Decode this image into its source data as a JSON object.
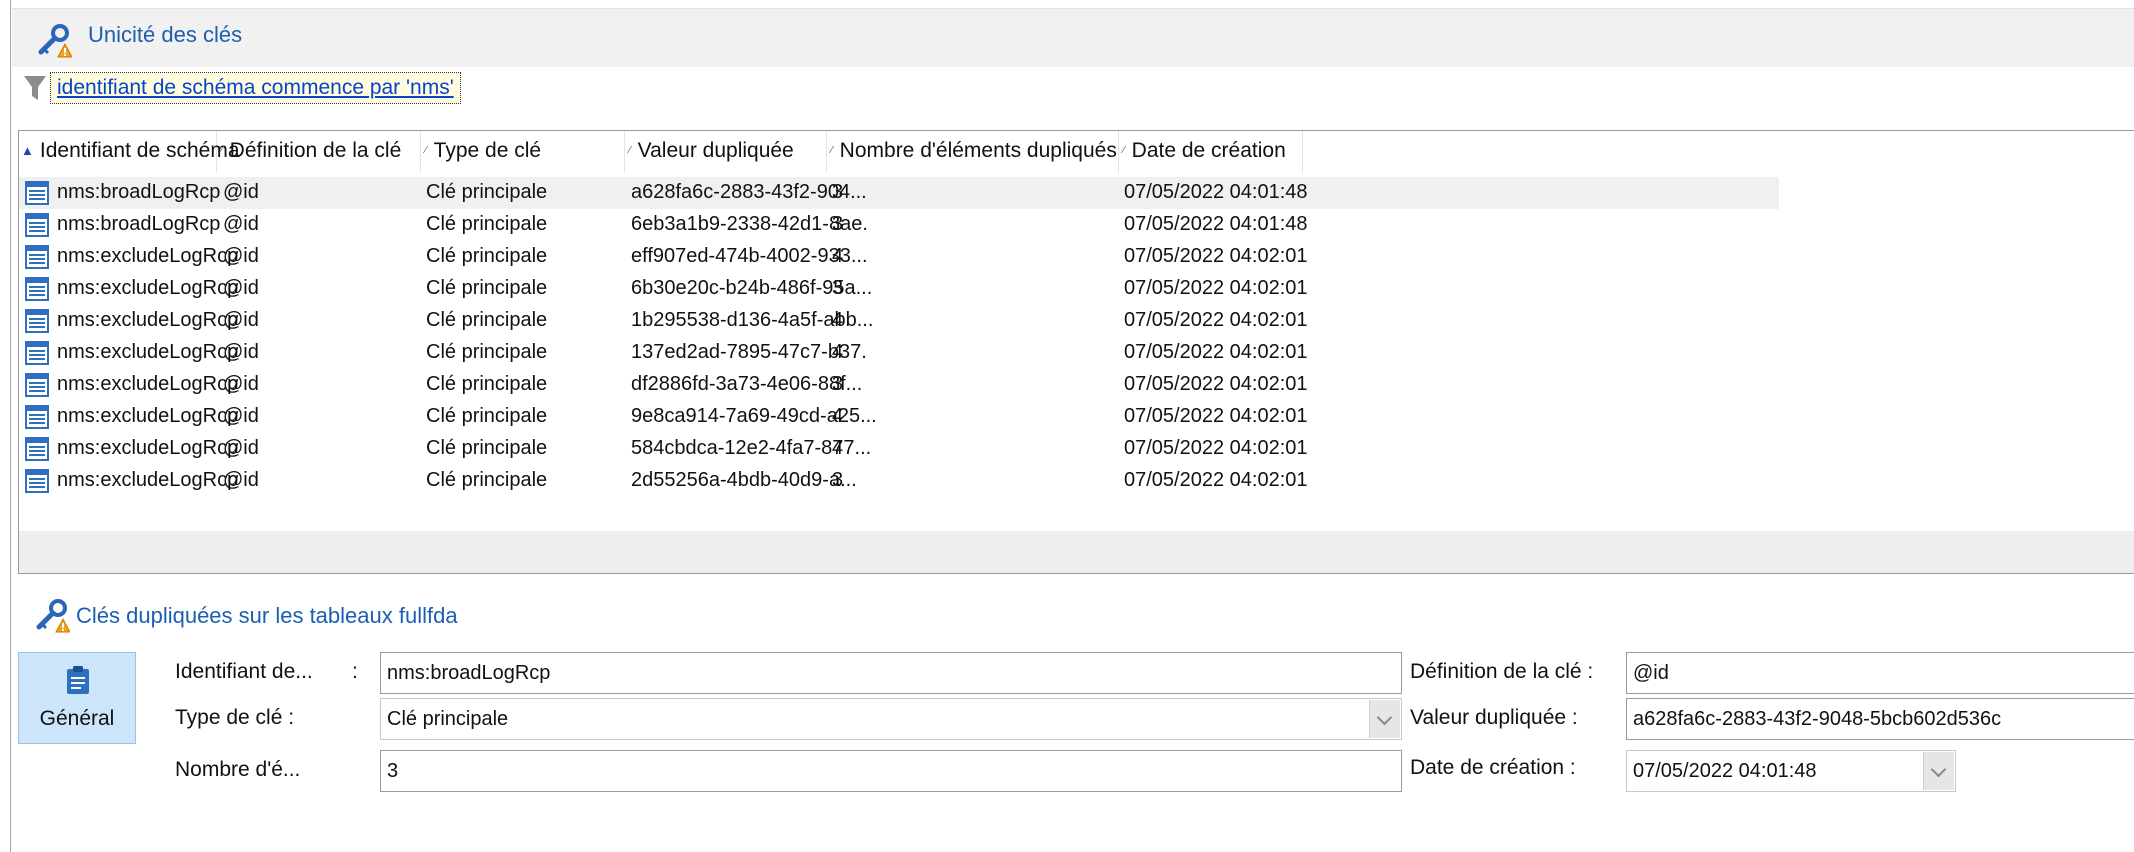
{
  "section_title": "Unicité des clés",
  "filter_text": "identifiant de schéma commence par 'nms'",
  "columns": [
    "Identifiant de schéma",
    "Définition de la clé",
    "Type de clé",
    "Valeur dupliquée",
    "Nombre d'éléments dupliqués",
    "Date de création"
  ],
  "rows": [
    [
      "nms:broadLogRcp",
      "@id",
      "Clé principale",
      "a628fa6c-2883-43f2-904...",
      "3",
      "07/05/2022 04:01:48"
    ],
    [
      "nms:broadLogRcp",
      "@id",
      "Clé principale",
      "6eb3a1b9-2338-42d1-8ae.",
      "3",
      "07/05/2022 04:01:48"
    ],
    [
      "nms:excludeLogRcp",
      "@id",
      "Clé principale",
      "eff907ed-474b-4002-933...",
      "4",
      "07/05/2022 04:02:01"
    ],
    [
      "nms:excludeLogRcp",
      "@id",
      "Clé principale",
      "6b30e20c-b24b-486f-95a...",
      "3",
      "07/05/2022 04:02:01"
    ],
    [
      "nms:excludeLogRcp",
      "@id",
      "Clé principale",
      "1b295538-d136-4a5f-abb...",
      "4",
      "07/05/2022 04:02:01"
    ],
    [
      "nms:excludeLogRcp",
      "@id",
      "Clé principale",
      "137ed2ad-7895-47c7-b37.",
      "4",
      "07/05/2022 04:02:01"
    ],
    [
      "nms:excludeLogRcp",
      "@id",
      "Clé principale",
      "df2886fd-3a73-4e06-88f...",
      "3",
      "07/05/2022 04:02:01"
    ],
    [
      "nms:excludeLogRcp",
      "@id",
      "Clé principale",
      "9e8ca914-7a69-49cd-a25...",
      "4",
      "07/05/2022 04:02:01"
    ],
    [
      "nms:excludeLogRcp",
      "@id",
      "Clé principale",
      "584cbdca-12e2-4fa7-877...",
      "4",
      "07/05/2022 04:02:01"
    ],
    [
      "nms:excludeLogRcp",
      "@id",
      "Clé principale",
      "2d55256a-4bdb-40d9-a...",
      "3",
      "07/05/2022 04:02:01"
    ]
  ],
  "detail": {
    "title": "Clés dupliquées sur les tableaux fullfda",
    "tab_label": "Général",
    "labels": {
      "schema": "Identifiant de...",
      "colon": ":",
      "key_type": "Type de clé :",
      "count": "Nombre d'é...",
      "key_def": "Définition de la clé :",
      "dup_value": "Valeur dupliquée :",
      "created": "Date de création :"
    },
    "values": {
      "schema": "nms:broadLogRcp",
      "key_type": "Clé principale",
      "count": "3",
      "key_def": "@id",
      "dup_value": "a628fa6c-2883-43f2-9048-5bcb602d536c",
      "created": "07/05/2022 04:01:48"
    }
  },
  "icons": {
    "section": "key-warning-icon",
    "filter": "funnel-icon",
    "row": "table-document-icon",
    "tab": "clipboard-icon"
  },
  "colors": {
    "accent_text": "#1c5fb0",
    "link": "#0645c9",
    "selected_tab": "#cde5fb"
  }
}
